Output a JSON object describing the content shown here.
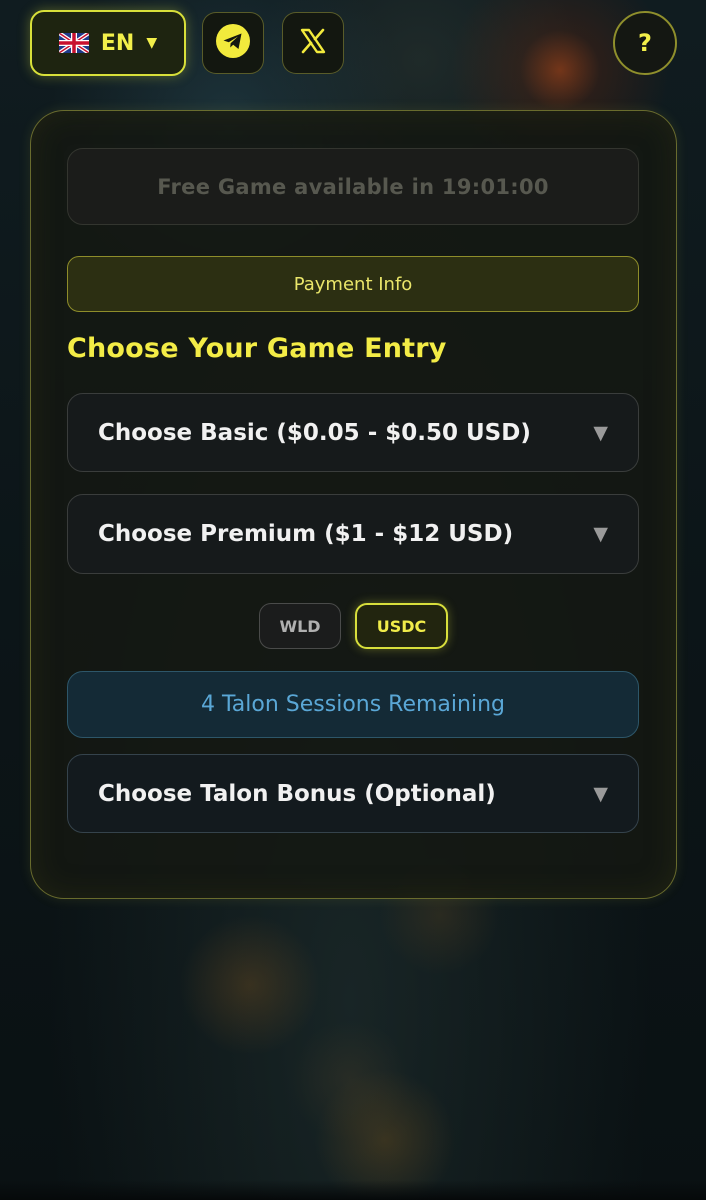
{
  "header": {
    "language": {
      "code": "EN",
      "flag_icon": "uk-flag-icon",
      "caret": "▼"
    },
    "social": [
      {
        "name": "telegram",
        "icon": "telegram-icon"
      },
      {
        "name": "x",
        "icon": "x-logo-icon"
      }
    ],
    "help_label": "?"
  },
  "panel": {
    "free_game_text": "Free Game available in 19:01:00",
    "payment_info_label": "Payment Info",
    "heading": "Choose Your Game Entry",
    "basic_select": {
      "label": "Choose Basic ($0.05 - $0.50 USD)",
      "arrow": "▼"
    },
    "premium_select": {
      "label": "Choose Premium ($1 - $12 USD)",
      "arrow": "▼"
    },
    "currency": {
      "options": [
        "WLD",
        "USDC"
      ],
      "selected": "USDC"
    },
    "sessions_text": "4 Talon Sessions Remaining",
    "talon_select": {
      "label": "Choose Talon Bonus (Optional)",
      "arrow": "▼"
    }
  },
  "colors": {
    "accent": "#f3ec46",
    "panel_border": "#d2d250",
    "info_blue": "#5aa7d6"
  }
}
